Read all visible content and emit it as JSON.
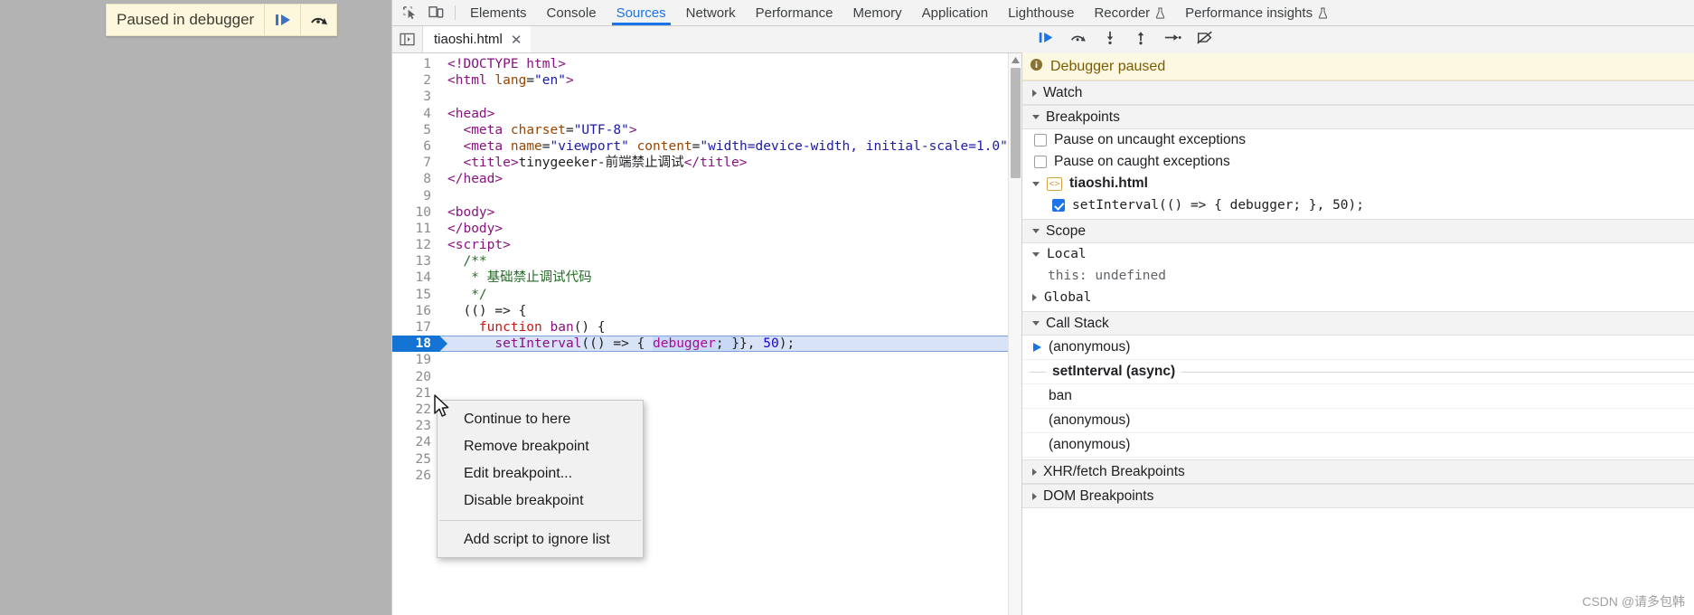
{
  "paused_overlay": {
    "label": "Paused in debugger",
    "resume_icon": "resume-script-execution-icon",
    "step_over_icon": "step-over-next-function-call-icon"
  },
  "devtools": {
    "toolbar": {
      "inspect_icon": "inspect-element-icon",
      "device_toolbar_icon": "toggle-device-toolbar-icon",
      "tabs": [
        {
          "label": "Elements",
          "active": false,
          "experimental": false
        },
        {
          "label": "Console",
          "active": false,
          "experimental": false
        },
        {
          "label": "Sources",
          "active": true,
          "experimental": false
        },
        {
          "label": "Network",
          "active": false,
          "experimental": false
        },
        {
          "label": "Performance",
          "active": false,
          "experimental": false
        },
        {
          "label": "Memory",
          "active": false,
          "experimental": false
        },
        {
          "label": "Application",
          "active": false,
          "experimental": false
        },
        {
          "label": "Lighthouse",
          "active": false,
          "experimental": false
        },
        {
          "label": "Recorder",
          "active": false,
          "experimental": true
        },
        {
          "label": "Performance insights",
          "active": false,
          "experimental": true
        }
      ]
    },
    "source_strip": {
      "navigator_toggle_icon": "show-navigator-panel-icon",
      "file_tab_label": "tiaoshi.html",
      "file_tab_close_icon": "close-icon",
      "debugger_toggle_icon": "show-debugger-sidebar-icon"
    },
    "debug_toolbar": {
      "resume_icon": "resume-script-execution-icon",
      "step_over_icon": "step-over-next-function-call-icon",
      "step_into_icon": "step-into-next-function-call-icon",
      "step_out_icon": "step-out-of-current-function-icon",
      "step_icon": "step-icon",
      "deactivate_breakpoints_icon": "deactivate-breakpoints-icon"
    }
  },
  "editor": {
    "lines": [
      {
        "num": "1",
        "tokens": [
          {
            "t": "tag",
            "v": "<!DOCTYPE html>"
          }
        ]
      },
      {
        "num": "2",
        "tokens": [
          {
            "t": "tag",
            "v": "<html "
          },
          {
            "t": "attr",
            "v": "lang"
          },
          {
            "t": "plain",
            "v": "="
          },
          {
            "t": "str",
            "v": "\"en\""
          },
          {
            "t": "tag",
            "v": ">"
          }
        ]
      },
      {
        "num": "3",
        "tokens": [
          {
            "t": "plain",
            "v": ""
          }
        ]
      },
      {
        "num": "4",
        "tokens": [
          {
            "t": "tag",
            "v": "<head>"
          }
        ]
      },
      {
        "num": "5",
        "tokens": [
          {
            "t": "plain",
            "v": "  "
          },
          {
            "t": "tag",
            "v": "<meta "
          },
          {
            "t": "attr",
            "v": "charset"
          },
          {
            "t": "plain",
            "v": "="
          },
          {
            "t": "str",
            "v": "\"UTF-8\""
          },
          {
            "t": "tag",
            "v": ">"
          }
        ]
      },
      {
        "num": "6",
        "tokens": [
          {
            "t": "plain",
            "v": "  "
          },
          {
            "t": "tag",
            "v": "<meta "
          },
          {
            "t": "attr",
            "v": "name"
          },
          {
            "t": "plain",
            "v": "="
          },
          {
            "t": "str",
            "v": "\"viewport\""
          },
          {
            "t": "plain",
            "v": " "
          },
          {
            "t": "attr",
            "v": "content"
          },
          {
            "t": "plain",
            "v": "="
          },
          {
            "t": "str",
            "v": "\"width=device-width, initial-scale=1.0\""
          },
          {
            "t": "tag",
            "v": ">"
          }
        ]
      },
      {
        "num": "7",
        "tokens": [
          {
            "t": "plain",
            "v": "  "
          },
          {
            "t": "tag",
            "v": "<title>"
          },
          {
            "t": "txt",
            "v": "tinygeeker-前端禁止调试"
          },
          {
            "t": "tag",
            "v": "</title>"
          }
        ]
      },
      {
        "num": "8",
        "tokens": [
          {
            "t": "tag",
            "v": "</head>"
          }
        ]
      },
      {
        "num": "9",
        "tokens": [
          {
            "t": "plain",
            "v": ""
          }
        ]
      },
      {
        "num": "10",
        "tokens": [
          {
            "t": "tag",
            "v": "<body>"
          }
        ]
      },
      {
        "num": "11",
        "tokens": [
          {
            "t": "tag",
            "v": "</body>"
          }
        ]
      },
      {
        "num": "12",
        "tokens": [
          {
            "t": "tag",
            "v": "<script>"
          }
        ]
      },
      {
        "num": "13",
        "tokens": [
          {
            "t": "plain",
            "v": "  "
          },
          {
            "t": "cmt",
            "v": "/**"
          }
        ]
      },
      {
        "num": "14",
        "tokens": [
          {
            "t": "plain",
            "v": "   "
          },
          {
            "t": "cmt",
            "v": "* 基础禁止调试代码"
          }
        ]
      },
      {
        "num": "15",
        "tokens": [
          {
            "t": "plain",
            "v": "   "
          },
          {
            "t": "cmt",
            "v": "*/"
          }
        ]
      },
      {
        "num": "16",
        "tokens": [
          {
            "t": "plain",
            "v": "  (() => {"
          }
        ]
      },
      {
        "num": "17",
        "tokens": [
          {
            "t": "plain",
            "v": "    "
          },
          {
            "t": "kw",
            "v": "function"
          },
          {
            "t": "plain",
            "v": " "
          },
          {
            "t": "fn",
            "v": "ban"
          },
          {
            "t": "plain",
            "v": "() {"
          }
        ]
      },
      {
        "num": "18",
        "breakpoint": true,
        "paused": true,
        "tokens": [
          {
            "t": "plain",
            "v": "      "
          },
          {
            "t": "fn",
            "v": "setInterval"
          },
          {
            "t": "plain",
            "v": "(() => { "
          },
          {
            "t": "dbg",
            "v": "debugger"
          },
          {
            "t": "sel",
            "v": "; }"
          },
          {
            "t": "plain",
            "v": "}, "
          },
          {
            "t": "num",
            "v": "50"
          },
          {
            "t": "plain",
            "v": ");"
          }
        ]
      },
      {
        "num": "19",
        "tokens": [
          {
            "t": "plain",
            "v": ""
          }
        ]
      },
      {
        "num": "20",
        "tokens": [
          {
            "t": "plain",
            "v": ""
          }
        ]
      },
      {
        "num": "21",
        "tokens": [
          {
            "t": "plain",
            "v": ""
          }
        ]
      },
      {
        "num": "22",
        "tokens": [
          {
            "t": "plain",
            "v": ""
          }
        ]
      },
      {
        "num": "23",
        "tokens": [
          {
            "t": "plain",
            "v": ""
          }
        ]
      },
      {
        "num": "24",
        "tokens": [
          {
            "t": "plain",
            "v": ""
          }
        ]
      },
      {
        "num": "25",
        "tokens": [
          {
            "t": "plain",
            "v": ""
          }
        ]
      },
      {
        "num": "26",
        "tokens": [
          {
            "t": "plain",
            "v": ""
          }
        ]
      }
    ]
  },
  "context_menu": {
    "items": [
      {
        "label": "Continue to here",
        "separator_after": false
      },
      {
        "label": "Remove breakpoint",
        "separator_after": false
      },
      {
        "label": "Edit breakpoint...",
        "separator_after": false
      },
      {
        "label": "Disable breakpoint",
        "separator_after": true
      },
      {
        "label": "Add script to ignore list",
        "separator_after": false
      }
    ]
  },
  "sidebar": {
    "banner": {
      "icon": "info-icon",
      "text": "Debugger paused"
    },
    "watch": {
      "label": "Watch",
      "expanded": false
    },
    "breakpoints": {
      "label": "Breakpoints",
      "expanded": true,
      "pause_uncaught": {
        "label": "Pause on uncaught exceptions",
        "checked": false
      },
      "pause_caught": {
        "label": "Pause on caught exceptions",
        "checked": false
      },
      "file": {
        "label": "tiaoshi.html",
        "icon": "source-file-icon",
        "expanded": true
      },
      "entries": [
        {
          "label": "setInterval(() => { debugger; }, 50);",
          "checked": true
        }
      ]
    },
    "scope": {
      "label": "Scope",
      "expanded": true,
      "local": {
        "label": "Local",
        "expanded": true
      },
      "local_vars": [
        {
          "label": "this: undefined"
        }
      ],
      "global": {
        "label": "Global",
        "expanded": false
      }
    },
    "call_stack": {
      "label": "Call Stack",
      "expanded": true,
      "frames": [
        {
          "label": "(anonymous)",
          "selected": true,
          "async": false,
          "bold": false
        },
        {
          "label": "setInterval (async)",
          "selected": false,
          "async": true,
          "bold": true
        },
        {
          "label": "ban",
          "selected": false,
          "async": false,
          "bold": false
        },
        {
          "label": "(anonymous)",
          "selected": false,
          "async": false,
          "bold": false
        },
        {
          "label": "(anonymous)",
          "selected": false,
          "async": false,
          "bold": false
        }
      ]
    },
    "xhr_breakpoints": {
      "label": "XHR/fetch Breakpoints",
      "expanded": false
    },
    "dom_breakpoints": {
      "label": "DOM Breakpoints",
      "expanded": false
    }
  },
  "watermark": "CSDN @请多包韩"
}
